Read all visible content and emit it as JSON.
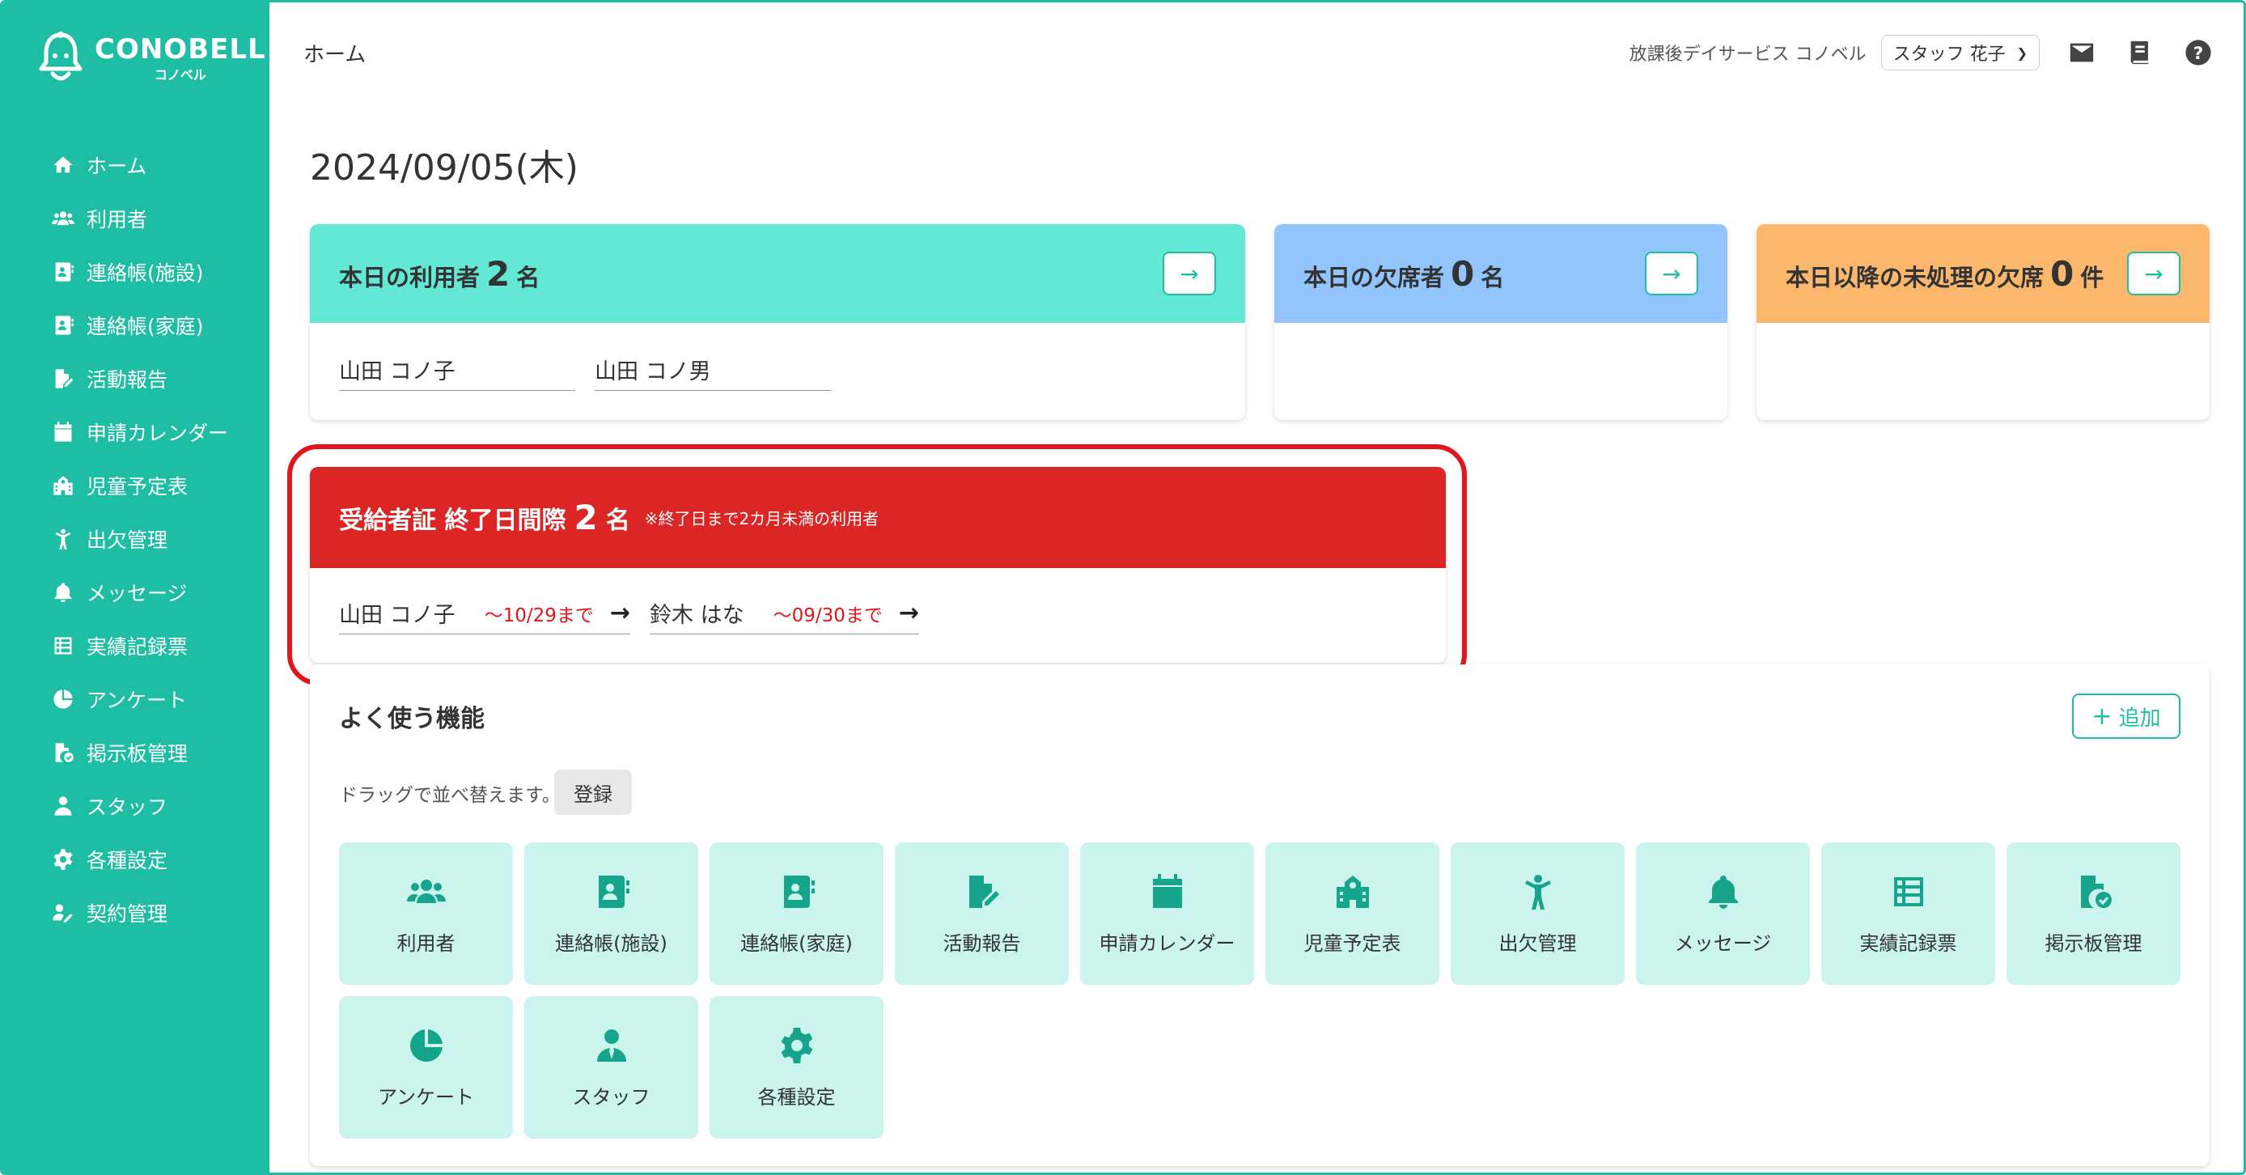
{
  "logo": {
    "main": "CONOBELL",
    "sub": "コノベル"
  },
  "sidebar": {
    "items": [
      {
        "label": "ホーム",
        "icon": "home-icon"
      },
      {
        "label": "利用者",
        "icon": "users-icon"
      },
      {
        "label": "連絡帳(施設)",
        "icon": "contact-book-icon"
      },
      {
        "label": "連絡帳(家庭)",
        "icon": "contact-book-icon"
      },
      {
        "label": "活動報告",
        "icon": "edit-document-icon"
      },
      {
        "label": "申請カレンダー",
        "icon": "calendar-icon"
      },
      {
        "label": "児童予定表",
        "icon": "school-icon"
      },
      {
        "label": "出欠管理",
        "icon": "child-icon"
      },
      {
        "label": "メッセージ",
        "icon": "bell-icon"
      },
      {
        "label": "実績記録票",
        "icon": "list-icon"
      },
      {
        "label": "アンケート",
        "icon": "pie-chart-icon"
      },
      {
        "label": "掲示板管理",
        "icon": "document-check-icon"
      },
      {
        "label": "スタッフ",
        "icon": "staff-icon"
      },
      {
        "label": "各種設定",
        "icon": "gear-icon"
      },
      {
        "label": "契約管理",
        "icon": "contract-icon"
      }
    ]
  },
  "topbar": {
    "breadcrumb": "ホーム",
    "facility": "放課後デイサービス コノベル",
    "staff": "スタッフ 花子"
  },
  "date": "2024/09/05(木)",
  "cards": {
    "today_users": {
      "label": "本日の利用者",
      "count": "2",
      "unit": "名",
      "names": [
        "山田 コノ子",
        "山田 コノ男"
      ],
      "color": "#62e8d4"
    },
    "today_absent": {
      "label": "本日の欠席者",
      "count": "0",
      "unit": "名",
      "color": "#93c5fd"
    },
    "pending_absent": {
      "label": "本日以降の未処理の欠席",
      "count": "0",
      "unit": "件",
      "color": "#fbb86d"
    }
  },
  "alert": {
    "label": "受給者証 終了日間際",
    "count": "2",
    "unit": "名",
    "note": "※終了日まで2カ月未満の利用者",
    "users": [
      {
        "name": "山田 コノ子",
        "until": "〜10/29まで"
      },
      {
        "name": "鈴木 はな",
        "until": "〜09/30まで"
      }
    ]
  },
  "features": {
    "title": "よく使う機能",
    "add_label": "追加",
    "drag_note": "ドラッグで並べ替えます。",
    "register_label": "登録",
    "tiles": [
      {
        "label": "利用者",
        "icon": "users-icon"
      },
      {
        "label": "連絡帳(施設)",
        "icon": "contact-book-icon"
      },
      {
        "label": "連絡帳(家庭)",
        "icon": "contact-book-icon"
      },
      {
        "label": "活動報告",
        "icon": "edit-document-icon"
      },
      {
        "label": "申請カレンダー",
        "icon": "calendar-icon"
      },
      {
        "label": "児童予定表",
        "icon": "school-icon"
      },
      {
        "label": "出欠管理",
        "icon": "child-icon"
      },
      {
        "label": "メッセージ",
        "icon": "bell-icon"
      },
      {
        "label": "実績記録票",
        "icon": "list-icon"
      },
      {
        "label": "掲示板管理",
        "icon": "document-check-icon"
      },
      {
        "label": "アンケート",
        "icon": "pie-chart-icon"
      },
      {
        "label": "スタッフ",
        "icon": "staff-icon"
      },
      {
        "label": "各種設定",
        "icon": "gear-icon"
      }
    ]
  },
  "colors": {
    "brand": "#1ebea5",
    "alert": "#dc2626",
    "tile": "#cbf5ec"
  }
}
